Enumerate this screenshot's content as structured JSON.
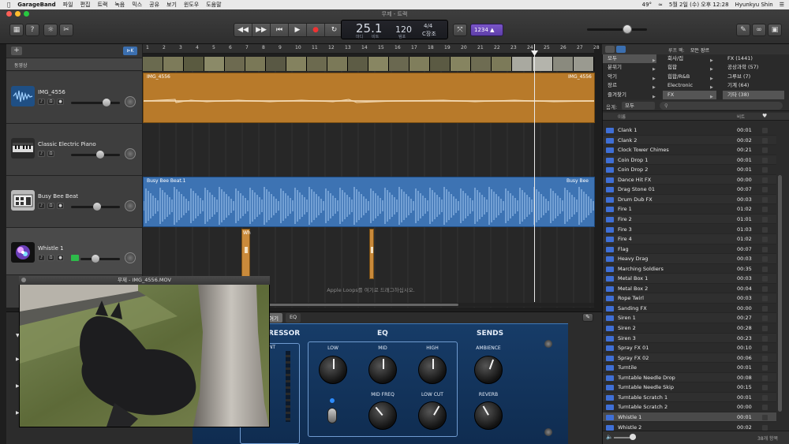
{
  "menubar": {
    "app": "GarageBand",
    "items": [
      "파일",
      "편집",
      "트랙",
      "녹음",
      "믹스",
      "공유",
      "보기",
      "윈도우",
      "도움말"
    ],
    "status": {
      "temp": "49°",
      "datetime": "5월 2일 (수) 오후 12:28",
      "user": "Hyunkyu Shin"
    }
  },
  "window": {
    "title": "무제 - 트랙"
  },
  "lcd": {
    "bar": "25.1",
    "bar_label": "마디",
    "beat_label": "비트",
    "tempo": "120",
    "tempo_label": "템포",
    "sig": "4/4",
    "key": "C장조"
  },
  "tuner": {
    "label": "1234"
  },
  "trackheader": {
    "add": "+",
    "smart": "⊳K",
    "video_label": "동영상"
  },
  "tracks": [
    {
      "name": "IMG_4556"
    },
    {
      "name": "Classic Electric Piano"
    },
    {
      "name": "Busy Bee Beat"
    },
    {
      "name": "Whistle 1"
    }
  ],
  "ruler": [
    "1",
    "2",
    "3",
    "4",
    "5",
    "6",
    "7",
    "8",
    "9",
    "10",
    "11",
    "12",
    "13",
    "14",
    "15",
    "16",
    "17",
    "18",
    "19",
    "20",
    "21",
    "22",
    "23",
    "24",
    "25",
    "26",
    "27",
    "28"
  ],
  "regions": {
    "audio1": "IMG_4556",
    "audio1_end": "IMG_4556",
    "beat": "Busy Bee Beat.1",
    "beat_end": "Busy Bee",
    "whistle": "Wh"
  },
  "arrange": {
    "drop_msg": "Apple Loops를 여기로 드래그하십시오."
  },
  "editor": {
    "tabs": [
      "제어기",
      "EQ"
    ],
    "compressor": "RESSOR",
    "compressor_knob": "NT",
    "eq": {
      "title": "EQ",
      "low": "LOW",
      "mid": "MID",
      "high": "HIGH",
      "mid_freq": "MID FREQ",
      "low_cut": "LOW CUT"
    },
    "sends": {
      "title": "SENDS",
      "ambience": "AMBIENCE",
      "reverb": "REVERB"
    }
  },
  "video_window": {
    "title": "무제 - IMG_4556.MOV"
  },
  "library": {
    "loop_pack_label": "루프 팩:",
    "loop_pack_value": "모든 장르",
    "categories": {
      "col1": [
        "모두",
        "분위기",
        "악기",
        "장르",
        "즐겨찾기"
      ],
      "col2": [
        "회사/집",
        "힙합",
        "힙합/R&B",
        "Electronic",
        "FX"
      ],
      "col3": [
        "FX (1441)",
        "공상과학 (57)",
        "그루브 (7)",
        "기계 (64)",
        "기타 (38)"
      ]
    },
    "scale_label": "음계:",
    "scale_value": "모두",
    "col_name": "이름",
    "col_beat": "비트",
    "rows": [
      {
        "name": "Clank 1",
        "beats": "00:01"
      },
      {
        "name": "Clank 2",
        "beats": "00:02"
      },
      {
        "name": "Clock Tower Chimes",
        "beats": "00:21"
      },
      {
        "name": "Coin Drop 1",
        "beats": "00:01"
      },
      {
        "name": "Coin Drop 2",
        "beats": "00:01"
      },
      {
        "name": "Dance Hit FX",
        "beats": "00:00"
      },
      {
        "name": "Drag Stone 01",
        "beats": "00:07"
      },
      {
        "name": "Drum Dub FX",
        "beats": "00:03"
      },
      {
        "name": "Fire 1",
        "beats": "01:02"
      },
      {
        "name": "Fire 2",
        "beats": "01:01"
      },
      {
        "name": "Fire 3",
        "beats": "01:03"
      },
      {
        "name": "Fire 4",
        "beats": "01:02"
      },
      {
        "name": "Flag",
        "beats": "00:07"
      },
      {
        "name": "Heavy Drag",
        "beats": "00:03"
      },
      {
        "name": "Marching Soldiers",
        "beats": "00:35"
      },
      {
        "name": "Metal Box 1",
        "beats": "00:03"
      },
      {
        "name": "Metal Box 2",
        "beats": "00:04"
      },
      {
        "name": "Rope Twirl",
        "beats": "00:03"
      },
      {
        "name": "Sanding FX",
        "beats": "00:00"
      },
      {
        "name": "Siren 1",
        "beats": "00:27"
      },
      {
        "name": "Siren 2",
        "beats": "00:28"
      },
      {
        "name": "Siren 3",
        "beats": "00:23"
      },
      {
        "name": "Spray FX 01",
        "beats": "00:10"
      },
      {
        "name": "Spray FX 02",
        "beats": "00:06"
      },
      {
        "name": "Turntile",
        "beats": "00:01"
      },
      {
        "name": "Turntable Needle Drop",
        "beats": "00:08"
      },
      {
        "name": "Turntable Needle Skip",
        "beats": "00:15"
      },
      {
        "name": "Turntable Scratch 1",
        "beats": "00:01"
      },
      {
        "name": "Turntable Scratch 2",
        "beats": "00:00"
      },
      {
        "name": "Whistle 1",
        "beats": "00:01"
      },
      {
        "name": "Whistle 2",
        "beats": "00:02"
      }
    ],
    "count": "38개 항목"
  },
  "colors": {
    "accent": "#3f6fd6",
    "audio_region": "#b87a2a",
    "beat_region": "#3d73b3",
    "tuner": "#6b4bbd"
  }
}
